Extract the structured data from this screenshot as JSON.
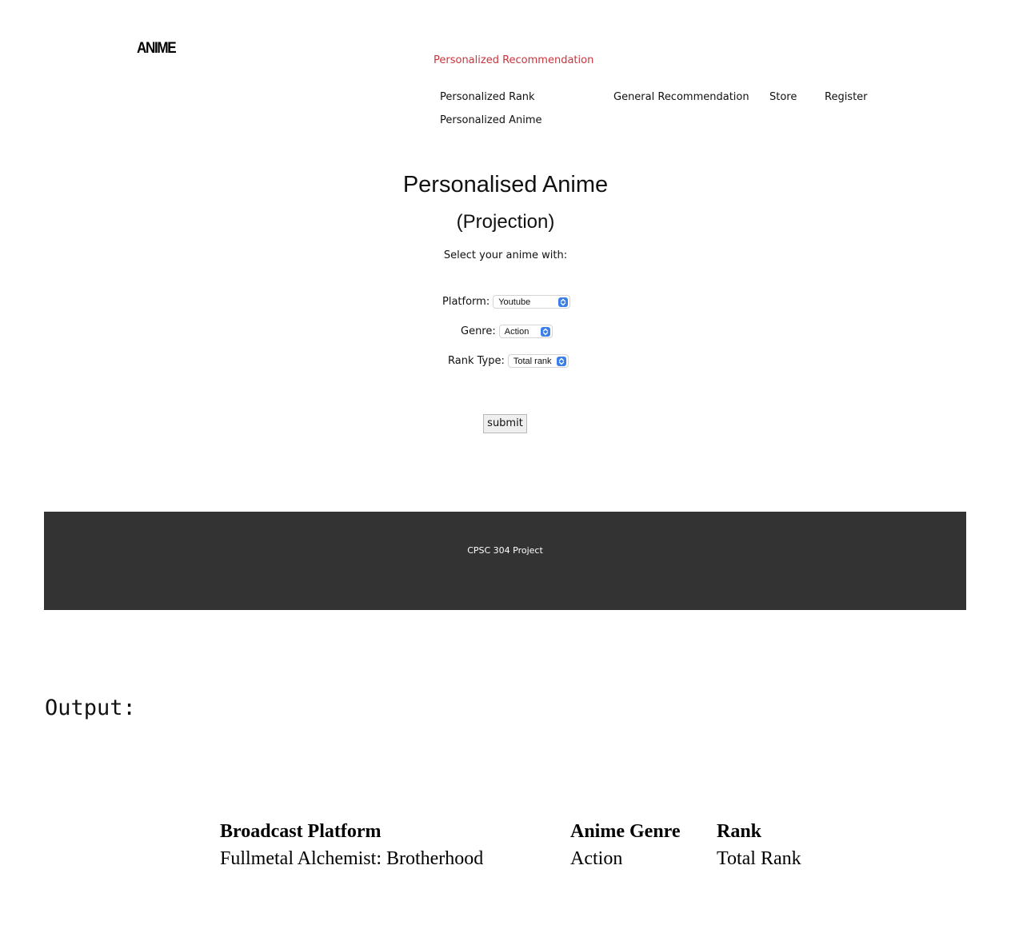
{
  "header": {
    "logo": "ANIME",
    "nav": {
      "active": "Personalized Recommendation",
      "items": [
        "Personalized Rank",
        "Personalized Anime",
        "General Recommendation",
        "Store",
        "Register"
      ]
    }
  },
  "main": {
    "title": "Personalised Anime",
    "subtitle": "(Projection)",
    "instruction": "Select your anime with:",
    "fields": {
      "platform": {
        "label": "Platform:",
        "value": "Youtube"
      },
      "genre": {
        "label": "Genre:",
        "value": "Action"
      },
      "rank_type": {
        "label": "Rank Type:",
        "value": "Total rank"
      }
    },
    "submit_label": "submit"
  },
  "footer": {
    "text": "CPSC 304 Project"
  },
  "output": {
    "label": "Output:",
    "table": {
      "headers": [
        "Broadcast Platform",
        "Anime Genre",
        "Rank"
      ],
      "rows": [
        [
          "Fullmetal Alchemist: Brotherhood",
          "Action",
          "Total Rank"
        ]
      ]
    }
  },
  "colors": {
    "active_nav": "#c9353c",
    "footer_bg": "#333333",
    "select_accent": "#3b7ee8"
  }
}
